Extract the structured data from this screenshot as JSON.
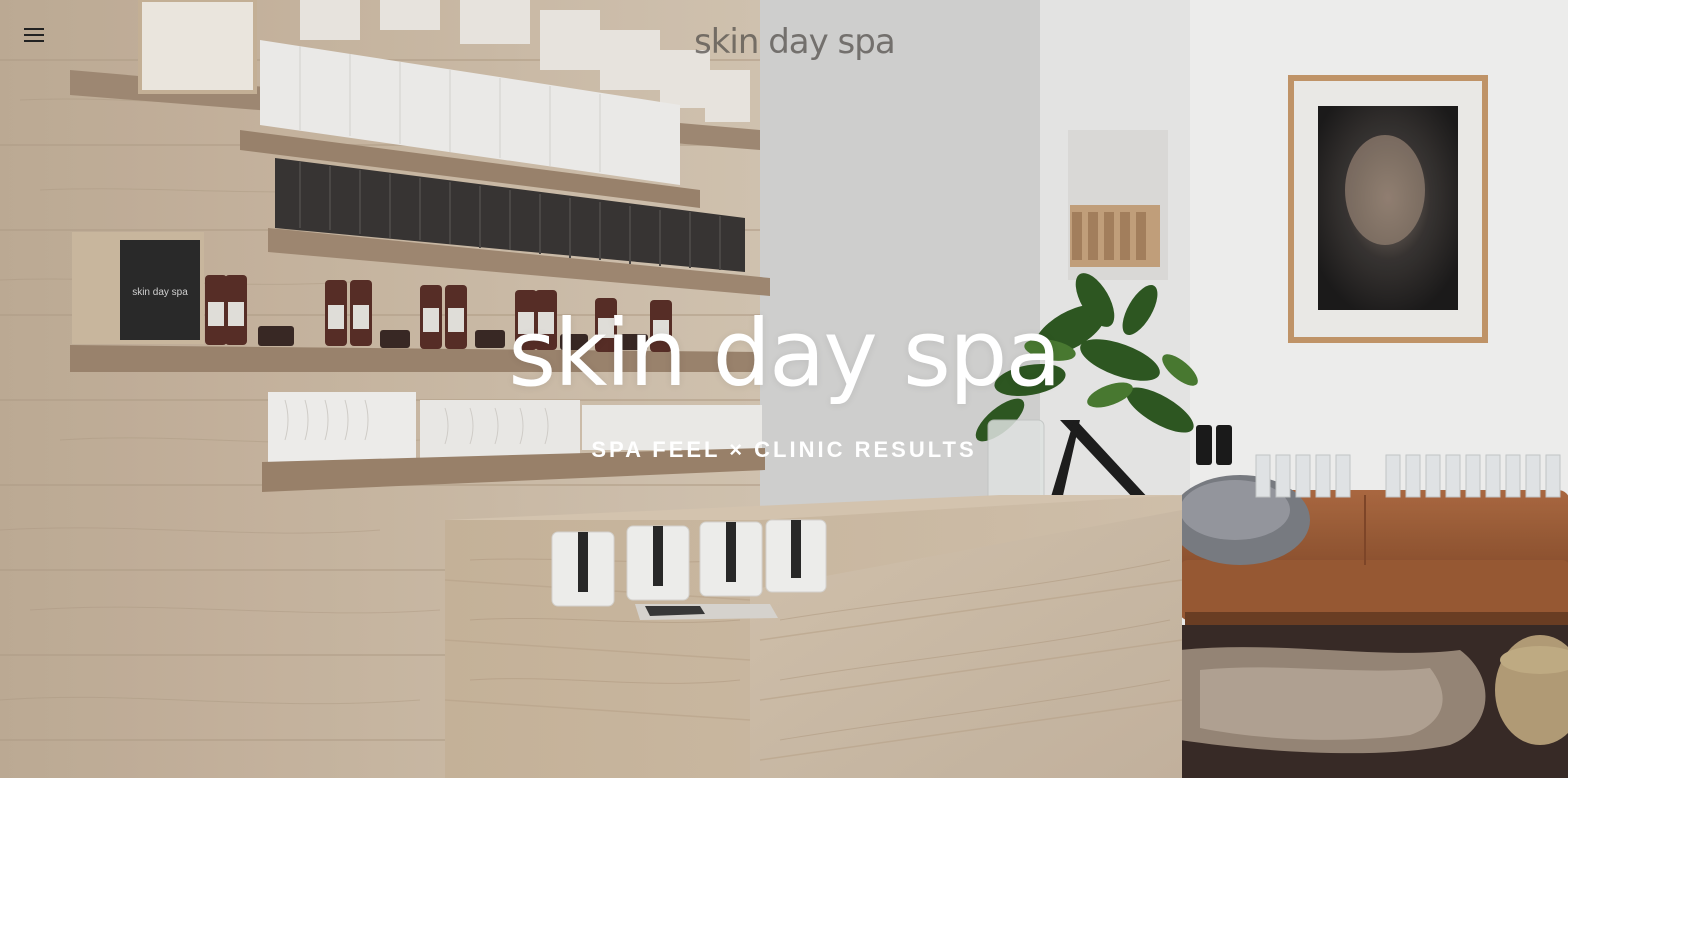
{
  "header": {
    "menu_icon": "hamburger-menu-icon",
    "logo_text": "skin day spa"
  },
  "hero": {
    "title": "skin day spa",
    "tagline": "SPA FEEL × CLINIC RESULTS",
    "shelf_sign_text": "skin day spa",
    "colors": {
      "wall_wood": "#c9b7a1",
      "white_wall": "#f2f2f1",
      "counter_wood": "#d6c6b1",
      "sofa_leather": "#a9643c",
      "dark_floor": "#3a2c28"
    }
  }
}
